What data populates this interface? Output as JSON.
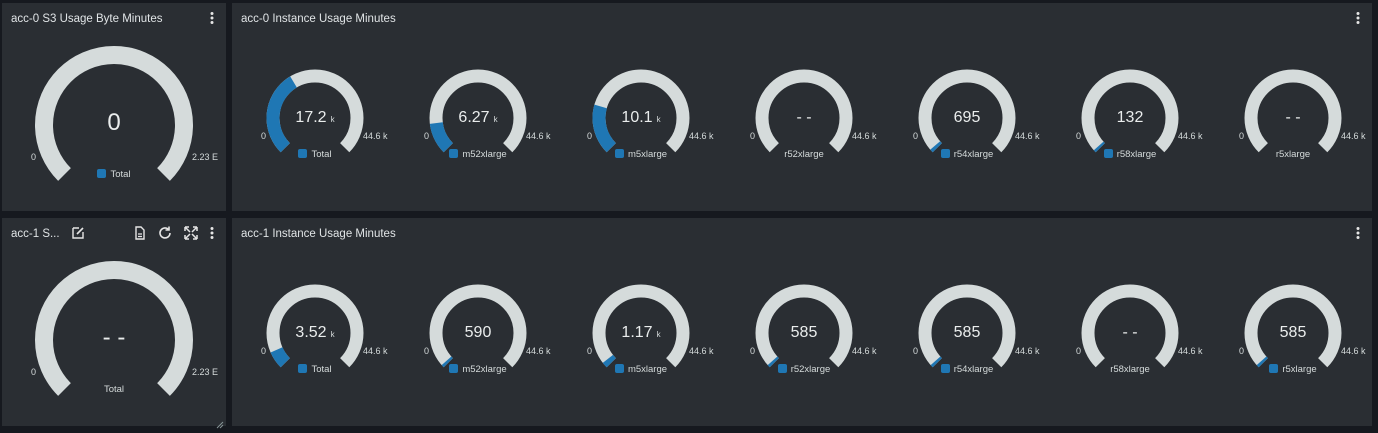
{
  "colors": {
    "accent": "#1f77b4",
    "track": "#d5dbdb",
    "panel": "#2a2e33",
    "background": "#16191f"
  },
  "rows": [
    {
      "s3": {
        "title": "acc-0 S3 Usage Byte Minutes",
        "value": "0",
        "unit": "",
        "min": "0",
        "max": "2.23 E",
        "legend": "Total",
        "swatch": true,
        "fraction": 0
      },
      "instances": {
        "title": "acc-0 Instance Usage Minutes",
        "gauges": [
          {
            "value": "17.2",
            "unit": "k",
            "min": "0",
            "max": "44.6 k",
            "legend": "Total",
            "swatch": true,
            "fraction": 0.386
          },
          {
            "value": "6.27",
            "unit": "k",
            "min": "0",
            "max": "44.6 k",
            "legend": "m52xlarge",
            "swatch": true,
            "fraction": 0.141
          },
          {
            "value": "10.1",
            "unit": "k",
            "min": "0",
            "max": "44.6 k",
            "legend": "m5xlarge",
            "swatch": true,
            "fraction": 0.226
          },
          {
            "value": "- -",
            "unit": "",
            "min": "0",
            "max": "44.6 k",
            "legend": "r52xlarge",
            "swatch": false,
            "fraction": 0
          },
          {
            "value": "695",
            "unit": "",
            "min": "0",
            "max": "44.6 k",
            "legend": "r54xlarge",
            "swatch": true,
            "fraction": 0.0156
          },
          {
            "value": "132",
            "unit": "",
            "min": "0",
            "max": "44.6 k",
            "legend": "r58xlarge",
            "swatch": true,
            "fraction": 0.003
          },
          {
            "value": "- -",
            "unit": "",
            "min": "0",
            "max": "44.6 k",
            "legend": "r5xlarge",
            "swatch": false,
            "fraction": 0
          }
        ]
      }
    },
    {
      "s3": {
        "title": "acc-1 S...",
        "value": "- -",
        "unit": "",
        "min": "0",
        "max": "2.23 E",
        "legend": "Total",
        "swatch": false,
        "fraction": 0
      },
      "instances": {
        "title": "acc-1 Instance Usage Minutes",
        "gauges": [
          {
            "value": "3.52",
            "unit": "k",
            "min": "0",
            "max": "44.6 k",
            "legend": "Total",
            "swatch": true,
            "fraction": 0.079
          },
          {
            "value": "590",
            "unit": "",
            "min": "0",
            "max": "44.6 k",
            "legend": "m52xlarge",
            "swatch": true,
            "fraction": 0.0132
          },
          {
            "value": "1.17",
            "unit": "k",
            "min": "0",
            "max": "44.6 k",
            "legend": "m5xlarge",
            "swatch": true,
            "fraction": 0.026
          },
          {
            "value": "585",
            "unit": "",
            "min": "0",
            "max": "44.6 k",
            "legend": "r52xlarge",
            "swatch": true,
            "fraction": 0.0131
          },
          {
            "value": "585",
            "unit": "",
            "min": "0",
            "max": "44.6 k",
            "legend": "r54xlarge",
            "swatch": true,
            "fraction": 0.0131
          },
          {
            "value": "- -",
            "unit": "",
            "min": "0",
            "max": "44.6 k",
            "legend": "r58xlarge",
            "swatch": false,
            "fraction": 0
          },
          {
            "value": "585",
            "unit": "",
            "min": "0",
            "max": "44.6 k",
            "legend": "r5xlarge",
            "swatch": true,
            "fraction": 0.0131
          }
        ]
      }
    }
  ],
  "toolbar": {
    "edit_icon": "edit-icon",
    "file_icon": "file-icon",
    "refresh_icon": "refresh-icon",
    "expand_icon": "expand-icon",
    "menu_icon": "kebab-menu-icon"
  }
}
